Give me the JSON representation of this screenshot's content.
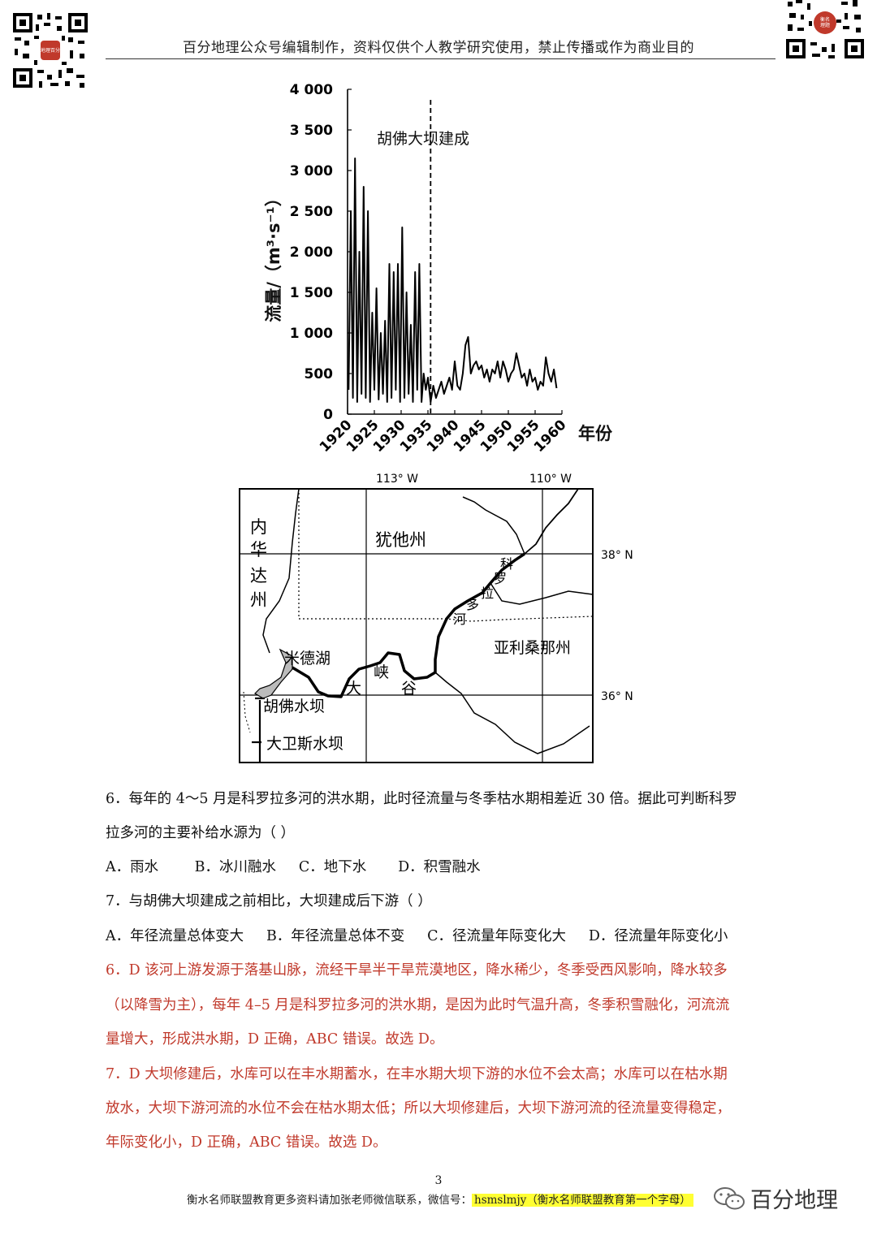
{
  "header": {
    "text": "百分地理公众号编辑制作，资料仅供个人教学研究使用，禁止传播或作为商业目的",
    "qr_left_label": "地理百分",
    "qr_right_label": "衡名理题"
  },
  "chart_data": {
    "type": "line",
    "title": "",
    "xlabel": "年份",
    "ylabel": "流量/（m³·s⁻¹）",
    "ylim": [
      0,
      4000
    ],
    "xlim": [
      1920,
      1960
    ],
    "yticks": [
      "0",
      "500",
      "1 000",
      "1 500",
      "2 000",
      "2 500",
      "3 000",
      "3 500",
      "4 000"
    ],
    "xticks": [
      "1920",
      "1925",
      "1930",
      "1935",
      "1940",
      "1945",
      "1950",
      "1955",
      "1960"
    ],
    "annotation": "胡佛大坝建成",
    "annotation_x": 1935.5,
    "x": [
      1920.2,
      1920.6,
      1921.0,
      1921.4,
      1921.8,
      1922.2,
      1922.6,
      1923.0,
      1923.4,
      1923.8,
      1924.2,
      1924.6,
      1925.0,
      1925.4,
      1925.8,
      1926.2,
      1926.6,
      1927.0,
      1927.4,
      1927.8,
      1928.2,
      1928.6,
      1929.0,
      1929.4,
      1929.8,
      1930.2,
      1930.6,
      1931.0,
      1931.4,
      1931.8,
      1932.2,
      1932.6,
      1933.0,
      1933.4,
      1933.8,
      1934.2,
      1934.6,
      1935.0,
      1935.5,
      1936.0,
      1936.5,
      1937.0,
      1937.5,
      1938.0,
      1938.5,
      1939.0,
      1939.5,
      1940.0,
      1940.5,
      1941.0,
      1941.5,
      1942.0,
      1942.5,
      1943.0,
      1943.5,
      1944.0,
      1944.5,
      1945.0,
      1945.5,
      1946.0,
      1946.5,
      1947.0,
      1947.5,
      1948.0,
      1948.5,
      1949.0,
      1949.5,
      1950.0,
      1950.5,
      1951.0,
      1951.5,
      1952.0,
      1952.5,
      1953.0,
      1953.5,
      1954.0,
      1954.5,
      1955.0,
      1955.5,
      1956.0,
      1956.5,
      1957.0,
      1957.5,
      1958.0,
      1958.5,
      1959.0
    ],
    "values": [
      300,
      2500,
      200,
      3150,
      150,
      2000,
      250,
      2800,
      200,
      2500,
      150,
      1250,
      300,
      1550,
      180,
      1000,
      250,
      1150,
      150,
      1850,
      200,
      1750,
      300,
      1850,
      150,
      2300,
      200,
      1500,
      250,
      1100,
      150,
      1750,
      300,
      1850,
      150,
      500,
      300,
      450,
      150,
      350,
      200,
      300,
      400,
      250,
      350,
      450,
      300,
      650,
      350,
      300,
      500,
      850,
      950,
      500,
      600,
      650,
      550,
      600,
      450,
      550,
      400,
      550,
      500,
      650,
      450,
      650,
      550,
      400,
      500,
      550,
      750,
      600,
      450,
      500,
      350,
      550,
      400,
      450,
      300,
      400,
      350,
      700,
      500,
      400,
      550,
      320
    ]
  },
  "map": {
    "lon_left": "113° W",
    "lon_right": "110° W",
    "lat_top": "38° N",
    "lat_bottom": "36° N",
    "nevada": [
      "内",
      "华",
      "达",
      "州"
    ],
    "utah": "犹他州",
    "arizona": "亚利桑那州",
    "lake_mead": "米德湖",
    "hoover": "胡佛水坝",
    "davis": "大卫斯水坝",
    "colorado": [
      "科",
      "罗",
      "拉",
      "多",
      "河"
    ],
    "canyon": [
      "大",
      "峡",
      "谷"
    ]
  },
  "questions": {
    "q6_line1": "6．每年的 4～5 月是科罗拉多河的洪水期，此时径流量与冬季枯水期相差近 30 倍。据此可判断科罗",
    "q6_line2": "拉多河的主要补给水源为（    ）",
    "q6_options": "A．雨水        B．冰川融水     C．地下水       D．积雪融水",
    "q7_line1": "7．与胡佛大坝建成之前相比，大坝建成后下游（    ）",
    "q7_options": "A．年径流量总体变大     B．年径流量总体不变     C．径流量年际变化大     D．径流量年际变化小"
  },
  "answers": {
    "a6_line1": "6．D 该河上游发源于落基山脉，流经干旱半干旱荒漠地区，降水稀少，冬季受西风影响，降水较多",
    "a6_line2": "（以降雪为主），每年 4–5 月是科罗拉多河的洪水期，是因为此时气温升高，冬季积雪融化，河流流",
    "a6_line3": "量增大，形成洪水期，D 正确，ABC 错误。故选 D。",
    "a7_line1": "7．D 大坝修建后，水库可以在丰水期蓄水，在丰水期大坝下游的水位不会太高；水库可以在枯水期",
    "a7_line2": "放水，大坝下游河流的水位不会在枯水期太低；所以大坝修建后，大坝下游河流的径流量变得稳定，",
    "a7_line3": "年际变化小，D 正确，ABC 错误。故选 D。"
  },
  "footer": {
    "page": "3",
    "text": "衡水名师联盟教育更多资料请加张老师微信联系，微信号：",
    "wechat_id": "hsmslmjy（衡水名师联盟教育第一个字母）",
    "brand": "百分地理"
  },
  "colors": {
    "answer_red": "#c0392b",
    "highlight_yellow": "#ffff33"
  }
}
